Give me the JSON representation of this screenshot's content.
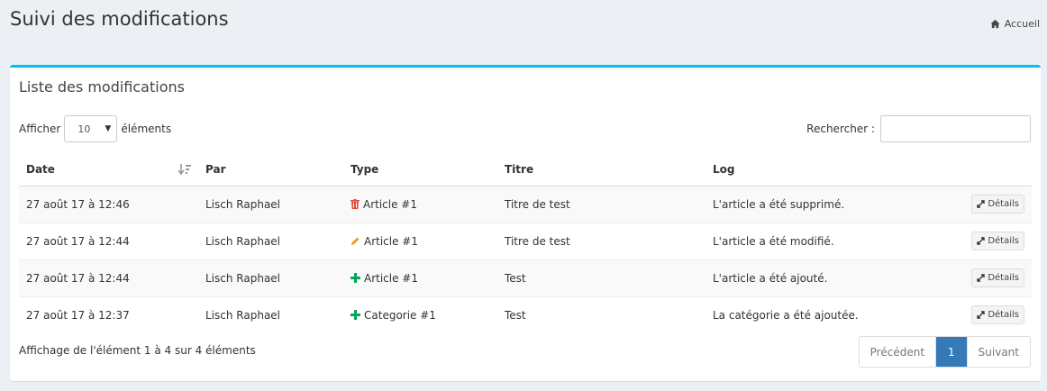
{
  "header": {
    "title": "Suivi des modifications",
    "breadcrumb": "Accueil"
  },
  "box": {
    "title": "Liste des modifications"
  },
  "length": {
    "before": "Afficher",
    "value": "10",
    "after": "éléments"
  },
  "search": {
    "label": "Rechercher :",
    "value": ""
  },
  "table": {
    "columns": [
      "Date",
      "Par",
      "Type",
      "Titre",
      "Log"
    ],
    "rows": [
      {
        "date": "27 août 17 à 12:46",
        "par": "Lisch Raphael",
        "type_icon": "trash-icon",
        "type_color": "#dd4b39",
        "type": "Article #1",
        "titre": "Titre de test",
        "log": "L'article a été supprimé.",
        "action": "Détails"
      },
      {
        "date": "27 août 17 à 12:44",
        "par": "Lisch Raphael",
        "type_icon": "pencil-icon",
        "type_color": "#f39c12",
        "type": "Article #1",
        "titre": "Titre de test",
        "log": "L'article a été modifié.",
        "action": "Détails"
      },
      {
        "date": "27 août 17 à 12:44",
        "par": "Lisch Raphael",
        "type_icon": "plus-icon",
        "type_color": "#00a65a",
        "type": "Article #1",
        "titre": "Test",
        "log": "L'article a été ajouté.",
        "action": "Détails"
      },
      {
        "date": "27 août 17 à 12:37",
        "par": "Lisch Raphael",
        "type_icon": "plus-icon",
        "type_color": "#00a65a",
        "type": "Categorie #1",
        "titre": "Test",
        "log": "La catégorie a été ajoutée.",
        "action": "Détails"
      }
    ]
  },
  "info": "Affichage de l'élément 1 à 4 sur 4 éléments",
  "pagination": {
    "prev": "Précédent",
    "current": "1",
    "next": "Suivant"
  },
  "colors": {
    "accent": "#00c0ef",
    "active_page": "#337ab7"
  }
}
